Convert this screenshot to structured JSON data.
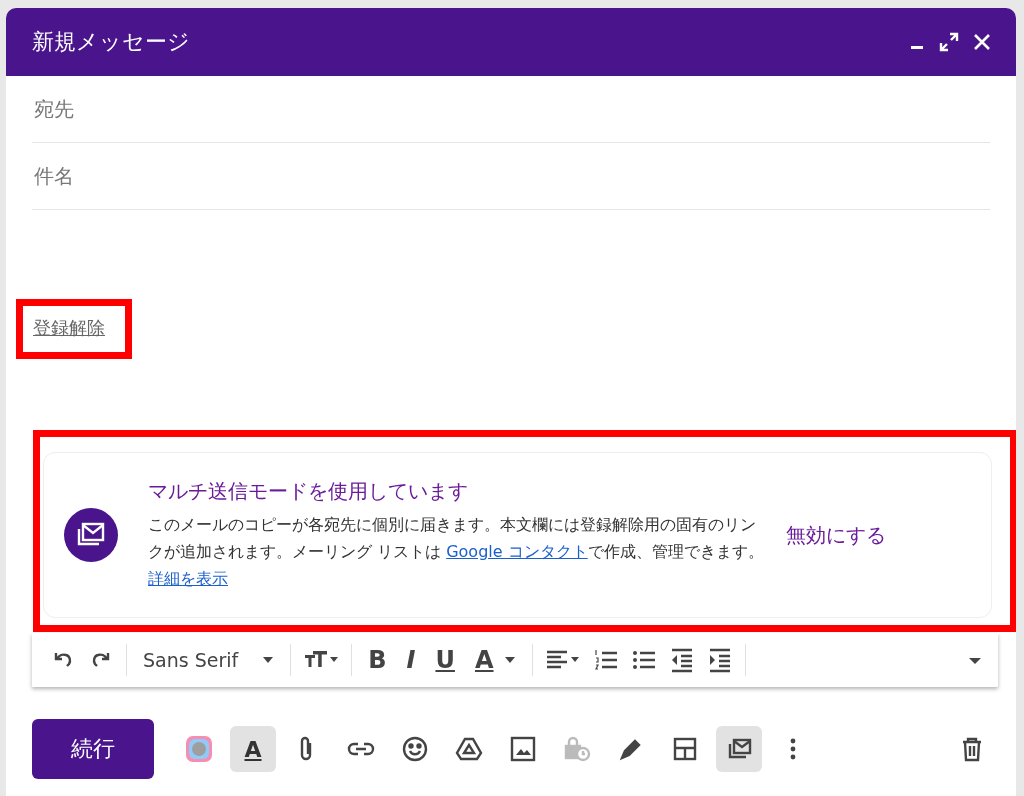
{
  "window": {
    "title": "新規メッセージ"
  },
  "fields": [
    {
      "placeholder": "宛先"
    },
    {
      "placeholder": "件名"
    }
  ],
  "body": {
    "unsubscribe_link": "登録解除"
  },
  "banner": {
    "title": "マルチ送信モードを使用しています",
    "text_before": "このメールのコピーが各宛先に個別に届きます。本文欄には登録解除用の固有のリンクが追加されます。メーリング リストは ",
    "contacts_link": "Google コンタクト",
    "text_after": "で作成、管理できます。 ",
    "details_link": "詳細を表示",
    "action": "無効にする"
  },
  "format_toolbar": [
    {
      "kind": "undo"
    },
    {
      "kind": "redo"
    },
    {
      "kind": "sep"
    },
    {
      "kind": "font",
      "label": "Sans Serif"
    },
    {
      "kind": "sep"
    },
    {
      "kind": "size"
    },
    {
      "kind": "sep"
    },
    {
      "kind": "bold",
      "label": "B"
    },
    {
      "kind": "italic",
      "label": "I"
    },
    {
      "kind": "underline",
      "label": "U"
    },
    {
      "kind": "color",
      "label": "A"
    },
    {
      "kind": "sep"
    },
    {
      "kind": "align"
    },
    {
      "kind": "numbered"
    },
    {
      "kind": "bulleted"
    },
    {
      "kind": "outdent"
    },
    {
      "kind": "indent"
    },
    {
      "kind": "sep"
    },
    {
      "kind": "more"
    }
  ],
  "send_button": "続行",
  "bottom_tools": [
    {
      "kind": "palette",
      "selected": false
    },
    {
      "kind": "formatting",
      "label": "A",
      "selected": true
    },
    {
      "kind": "attach",
      "selected": false
    },
    {
      "kind": "link",
      "selected": false
    },
    {
      "kind": "emoji",
      "selected": false
    },
    {
      "kind": "drive",
      "selected": false
    },
    {
      "kind": "photo",
      "selected": false
    },
    {
      "kind": "lock",
      "selected": false
    },
    {
      "kind": "pen",
      "selected": false
    },
    {
      "kind": "layout",
      "selected": false
    },
    {
      "kind": "multisend",
      "selected": true
    },
    {
      "kind": "dots",
      "selected": false
    }
  ]
}
